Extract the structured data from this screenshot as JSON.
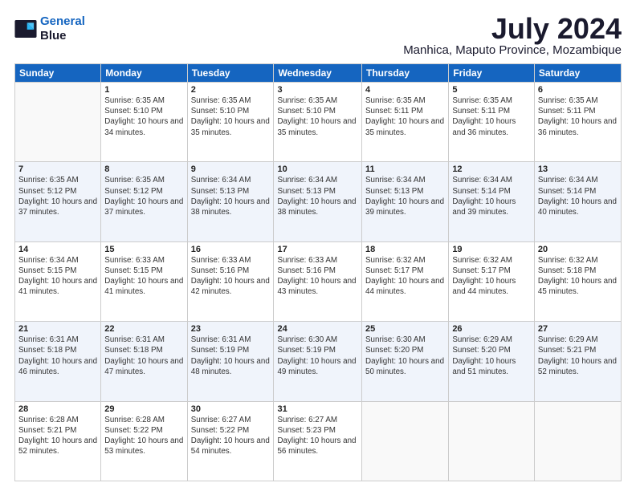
{
  "logo": {
    "line1": "General",
    "line2": "Blue"
  },
  "title": "July 2024",
  "subtitle": "Manhica, Maputo Province, Mozambique",
  "weekdays": [
    "Sunday",
    "Monday",
    "Tuesday",
    "Wednesday",
    "Thursday",
    "Friday",
    "Saturday"
  ],
  "weeks": [
    [
      {
        "day": "",
        "sunrise": "",
        "sunset": "",
        "daylight": ""
      },
      {
        "day": "1",
        "sunrise": "Sunrise: 6:35 AM",
        "sunset": "Sunset: 5:10 PM",
        "daylight": "Daylight: 10 hours and 34 minutes."
      },
      {
        "day": "2",
        "sunrise": "Sunrise: 6:35 AM",
        "sunset": "Sunset: 5:10 PM",
        "daylight": "Daylight: 10 hours and 35 minutes."
      },
      {
        "day": "3",
        "sunrise": "Sunrise: 6:35 AM",
        "sunset": "Sunset: 5:10 PM",
        "daylight": "Daylight: 10 hours and 35 minutes."
      },
      {
        "day": "4",
        "sunrise": "Sunrise: 6:35 AM",
        "sunset": "Sunset: 5:11 PM",
        "daylight": "Daylight: 10 hours and 35 minutes."
      },
      {
        "day": "5",
        "sunrise": "Sunrise: 6:35 AM",
        "sunset": "Sunset: 5:11 PM",
        "daylight": "Daylight: 10 hours and 36 minutes."
      },
      {
        "day": "6",
        "sunrise": "Sunrise: 6:35 AM",
        "sunset": "Sunset: 5:11 PM",
        "daylight": "Daylight: 10 hours and 36 minutes."
      }
    ],
    [
      {
        "day": "7",
        "sunrise": "Sunrise: 6:35 AM",
        "sunset": "Sunset: 5:12 PM",
        "daylight": "Daylight: 10 hours and 37 minutes."
      },
      {
        "day": "8",
        "sunrise": "Sunrise: 6:35 AM",
        "sunset": "Sunset: 5:12 PM",
        "daylight": "Daylight: 10 hours and 37 minutes."
      },
      {
        "day": "9",
        "sunrise": "Sunrise: 6:34 AM",
        "sunset": "Sunset: 5:13 PM",
        "daylight": "Daylight: 10 hours and 38 minutes."
      },
      {
        "day": "10",
        "sunrise": "Sunrise: 6:34 AM",
        "sunset": "Sunset: 5:13 PM",
        "daylight": "Daylight: 10 hours and 38 minutes."
      },
      {
        "day": "11",
        "sunrise": "Sunrise: 6:34 AM",
        "sunset": "Sunset: 5:13 PM",
        "daylight": "Daylight: 10 hours and 39 minutes."
      },
      {
        "day": "12",
        "sunrise": "Sunrise: 6:34 AM",
        "sunset": "Sunset: 5:14 PM",
        "daylight": "Daylight: 10 hours and 39 minutes."
      },
      {
        "day": "13",
        "sunrise": "Sunrise: 6:34 AM",
        "sunset": "Sunset: 5:14 PM",
        "daylight": "Daylight: 10 hours and 40 minutes."
      }
    ],
    [
      {
        "day": "14",
        "sunrise": "Sunrise: 6:34 AM",
        "sunset": "Sunset: 5:15 PM",
        "daylight": "Daylight: 10 hours and 41 minutes."
      },
      {
        "day": "15",
        "sunrise": "Sunrise: 6:33 AM",
        "sunset": "Sunset: 5:15 PM",
        "daylight": "Daylight: 10 hours and 41 minutes."
      },
      {
        "day": "16",
        "sunrise": "Sunrise: 6:33 AM",
        "sunset": "Sunset: 5:16 PM",
        "daylight": "Daylight: 10 hours and 42 minutes."
      },
      {
        "day": "17",
        "sunrise": "Sunrise: 6:33 AM",
        "sunset": "Sunset: 5:16 PM",
        "daylight": "Daylight: 10 hours and 43 minutes."
      },
      {
        "day": "18",
        "sunrise": "Sunrise: 6:32 AM",
        "sunset": "Sunset: 5:17 PM",
        "daylight": "Daylight: 10 hours and 44 minutes."
      },
      {
        "day": "19",
        "sunrise": "Sunrise: 6:32 AM",
        "sunset": "Sunset: 5:17 PM",
        "daylight": "Daylight: 10 hours and 44 minutes."
      },
      {
        "day": "20",
        "sunrise": "Sunrise: 6:32 AM",
        "sunset": "Sunset: 5:18 PM",
        "daylight": "Daylight: 10 hours and 45 minutes."
      }
    ],
    [
      {
        "day": "21",
        "sunrise": "Sunrise: 6:31 AM",
        "sunset": "Sunset: 5:18 PM",
        "daylight": "Daylight: 10 hours and 46 minutes."
      },
      {
        "day": "22",
        "sunrise": "Sunrise: 6:31 AM",
        "sunset": "Sunset: 5:18 PM",
        "daylight": "Daylight: 10 hours and 47 minutes."
      },
      {
        "day": "23",
        "sunrise": "Sunrise: 6:31 AM",
        "sunset": "Sunset: 5:19 PM",
        "daylight": "Daylight: 10 hours and 48 minutes."
      },
      {
        "day": "24",
        "sunrise": "Sunrise: 6:30 AM",
        "sunset": "Sunset: 5:19 PM",
        "daylight": "Daylight: 10 hours and 49 minutes."
      },
      {
        "day": "25",
        "sunrise": "Sunrise: 6:30 AM",
        "sunset": "Sunset: 5:20 PM",
        "daylight": "Daylight: 10 hours and 50 minutes."
      },
      {
        "day": "26",
        "sunrise": "Sunrise: 6:29 AM",
        "sunset": "Sunset: 5:20 PM",
        "daylight": "Daylight: 10 hours and 51 minutes."
      },
      {
        "day": "27",
        "sunrise": "Sunrise: 6:29 AM",
        "sunset": "Sunset: 5:21 PM",
        "daylight": "Daylight: 10 hours and 52 minutes."
      }
    ],
    [
      {
        "day": "28",
        "sunrise": "Sunrise: 6:28 AM",
        "sunset": "Sunset: 5:21 PM",
        "daylight": "Daylight: 10 hours and 52 minutes."
      },
      {
        "day": "29",
        "sunrise": "Sunrise: 6:28 AM",
        "sunset": "Sunset: 5:22 PM",
        "daylight": "Daylight: 10 hours and 53 minutes."
      },
      {
        "day": "30",
        "sunrise": "Sunrise: 6:27 AM",
        "sunset": "Sunset: 5:22 PM",
        "daylight": "Daylight: 10 hours and 54 minutes."
      },
      {
        "day": "31",
        "sunrise": "Sunrise: 6:27 AM",
        "sunset": "Sunset: 5:23 PM",
        "daylight": "Daylight: 10 hours and 56 minutes."
      },
      {
        "day": "",
        "sunrise": "",
        "sunset": "",
        "daylight": ""
      },
      {
        "day": "",
        "sunrise": "",
        "sunset": "",
        "daylight": ""
      },
      {
        "day": "",
        "sunrise": "",
        "sunset": "",
        "daylight": ""
      }
    ]
  ]
}
